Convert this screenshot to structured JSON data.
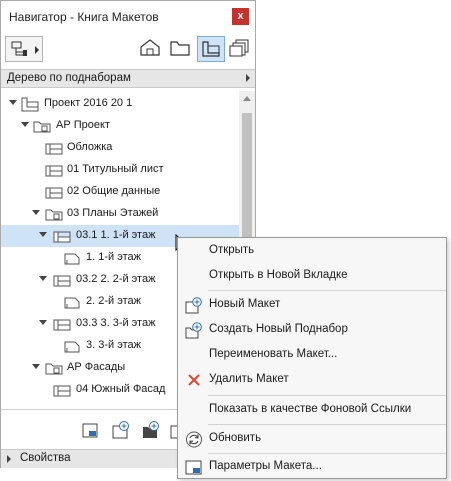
{
  "window": {
    "title": "Навигатор - Книга Макетов",
    "close_glyph": "x"
  },
  "subset_dropdown": {
    "label": "Дерево по поднаборам"
  },
  "tree": [
    {
      "label": "Проект 2016 20 1",
      "icon": "project-icon"
    },
    {
      "label": "АР Проект",
      "icon": "folder-icon"
    },
    {
      "label": "Обложка",
      "icon": "layout-icon"
    },
    {
      "label": "01 Титульный лист",
      "icon": "layout-icon"
    },
    {
      "label": "02 Общие данные",
      "icon": "layout-icon"
    },
    {
      "label": "03 Планы Этажей",
      "icon": "folder-icon"
    },
    {
      "label": "03.1 1. 1-й этаж",
      "icon": "layout-icon"
    },
    {
      "label": "1. 1-й этаж",
      "icon": "drawing-icon"
    },
    {
      "label": "03.2 2. 2-й этаж",
      "icon": "layout-icon"
    },
    {
      "label": "2. 2-й этаж",
      "icon": "drawing-icon"
    },
    {
      "label": "03.3 3. 3-й этаж",
      "icon": "layout-icon"
    },
    {
      "label": "3. 3-й этаж",
      "icon": "drawing-icon"
    },
    {
      "label": "АР Фасады",
      "icon": "folder-icon"
    },
    {
      "label": "04 Южный Фасад",
      "icon": "layout-icon"
    }
  ],
  "properties": {
    "label": "Свойства"
  },
  "context_menu": {
    "open": "Открыть",
    "open_new_tab": "Открыть в Новой Вкладке",
    "new_layout": "Новый Макет",
    "new_subset": "Создать Новый Поднабор",
    "rename": "Переименовать Макет...",
    "delete": "Удалить Макет",
    "show_as_reference": "Показать в качестве Фоновой Ссылки",
    "refresh": "Обновить",
    "layout_settings": "Параметры Макета..."
  },
  "colors": {
    "selection": "#cfe3f7",
    "close": "#c8302c",
    "delete": "#e0432c",
    "icon_blue": "#2d6db5"
  }
}
